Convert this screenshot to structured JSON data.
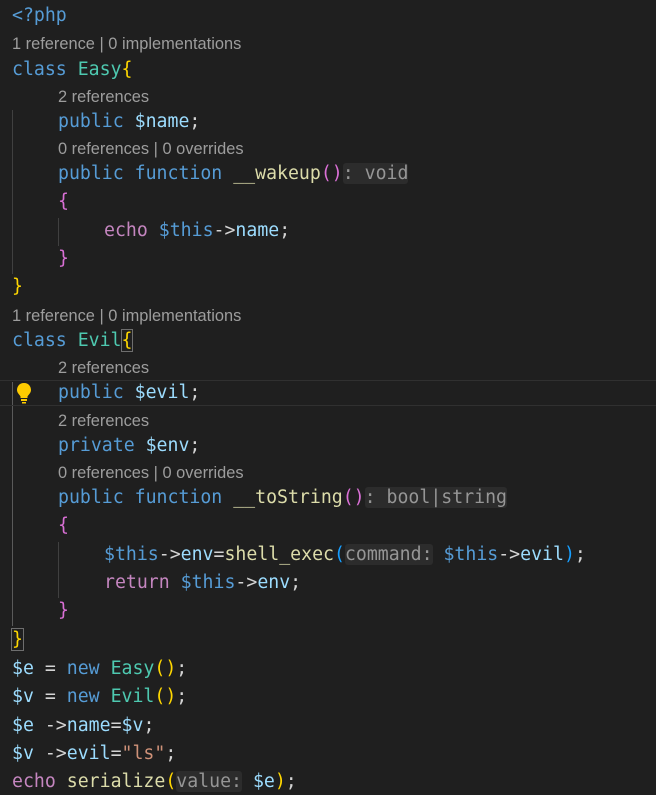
{
  "editor": {
    "language": "php",
    "theme_colors": {
      "background": "#1f1f1f",
      "keyword": "#569cd6",
      "control": "#c586c0",
      "class_name": "#4ec9b0",
      "variable": "#9cdcfe",
      "function": "#dcdcaa",
      "string": "#ce9178",
      "codelens": "#9d9d9d",
      "bracket_level1": "#ffd700",
      "bracket_level2": "#da70d6",
      "bracket_level3": "#179fff"
    },
    "lightbulb_icon": "lightbulb-icon",
    "code": {
      "php_open": "<?php",
      "kw_class": "class",
      "kw_public": "public",
      "kw_private": "private",
      "kw_function": "function",
      "kw_new": "new",
      "kw_echo": "echo",
      "kw_return": "return",
      "type_void": "void",
      "type_bool": "bool",
      "type_string": "string",
      "class_easy": "Easy",
      "class_evil": "Evil",
      "var_name": "$name",
      "var_evil": "$evil",
      "var_env": "$env",
      "var_this": "$this",
      "var_e": "$e",
      "var_v": "$v",
      "prop_name": "name",
      "prop_evil": "evil",
      "prop_env": "env",
      "fn_wakeup": "__wakeup",
      "fn_tostring": "__toString",
      "fn_shell_exec": "shell_exec",
      "fn_serialize": "serialize",
      "hint_command": "command:",
      "hint_value": "value:",
      "str_ls": "\"ls\""
    },
    "codelens": {
      "class_easy": "1 reference | 0 implementations",
      "prop_name": "2 references",
      "method_wakeup": "0 references | 0 overrides",
      "class_evil": "1 reference | 0 implementations",
      "prop_evil": "2 references",
      "prop_env": "2 references",
      "method_tostring": "0 references | 0 overrides"
    }
  }
}
